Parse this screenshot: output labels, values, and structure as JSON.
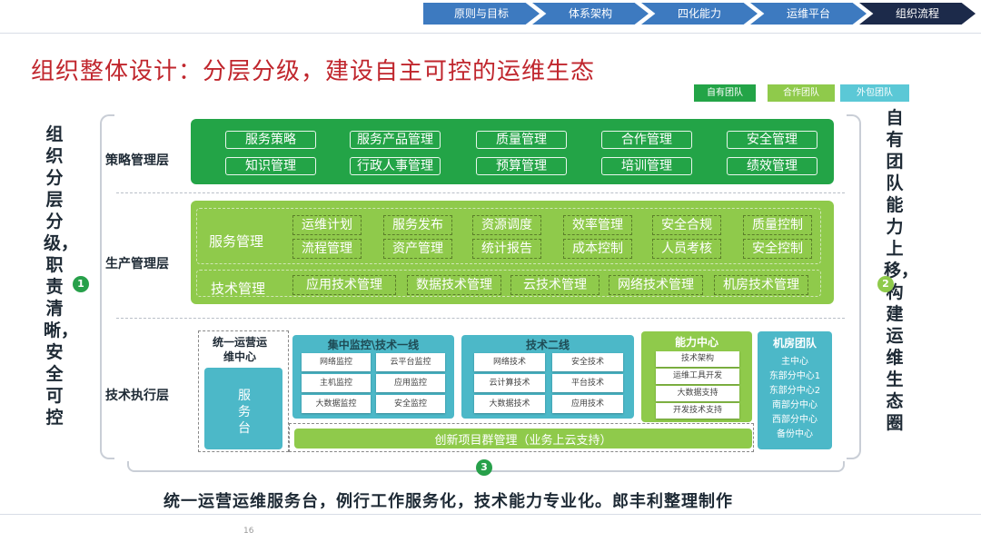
{
  "nav": {
    "items": [
      "原则与目标",
      "体系架构",
      "四化能力",
      "运维平台",
      "组织流程"
    ],
    "colors": [
      "#3d7ac0",
      "#3d7ac0",
      "#3d7ac0",
      "#3d7ac0",
      "#1c2a4a"
    ],
    "active_index": 4
  },
  "title": "组织整体设计：分层分级，建设自主可控的运维生态",
  "legend": [
    {
      "label": "自有团队",
      "color": "#23a447"
    },
    {
      "label": "合作团队",
      "color": "#8fca4b"
    },
    {
      "label": "外包团队",
      "color": "#5bc8d6"
    }
  ],
  "left_side_text": "组织分层分级，职责清晰，安全可控",
  "right_side_text": "自有团队能力上移，构建运维生态圈",
  "badges": [
    "1",
    "2",
    "3"
  ],
  "layers": {
    "strategy": {
      "label": "策略管理层",
      "items": [
        "服务策略",
        "服务产品管理",
        "质量管理",
        "合作管理",
        "安全管理",
        "知识管理",
        "行政人事管理",
        "预算管理",
        "培训管理",
        "绩效管理"
      ]
    },
    "production": {
      "label": "生产管理层",
      "service_label": "服务管理",
      "service_items": [
        "运维计划",
        "服务发布",
        "资源调度",
        "效率管理",
        "安全合规",
        "质量控制",
        "流程管理",
        "资产管理",
        "统计报告",
        "成本控制",
        "人员考核",
        "安全控制"
      ],
      "tech_label": "技术管理",
      "tech_items": [
        "应用技术管理",
        "数据技术管理",
        "云技术管理",
        "网络技术管理",
        "机房技术管理"
      ]
    },
    "execution": {
      "label": "技术执行层",
      "ops_center": {
        "title": "统一运营运维中心",
        "service_desk": "服务台"
      },
      "monitor": {
        "title": "集中监控\\技术一线",
        "items": [
          "网络监控",
          "云平台监控",
          "主机监控",
          "应用监控",
          "大数据监控",
          "安全监控"
        ]
      },
      "tier2": {
        "title": "技术二线",
        "items": [
          "网络技术",
          "安全技术",
          "云计算技术",
          "平台技术",
          "大数据技术",
          "应用技术"
        ]
      },
      "capability": {
        "title": "能力中心",
        "items": [
          "技术架构",
          "运维工具开发",
          "大数据支持",
          "开发技术支持"
        ]
      },
      "datacenter": {
        "title": "机房团队",
        "items": [
          "主中心",
          "东部分中心1",
          "东部分中心2",
          "南部分中心",
          "西部分中心",
          "备份中心"
        ]
      },
      "innovation": "创新项目群管理（业务上云支持）"
    }
  },
  "footer": "统一运营运维服务台，例行工作服务化，技术能力专业化。郎丰利整理制作",
  "page_number": "16"
}
